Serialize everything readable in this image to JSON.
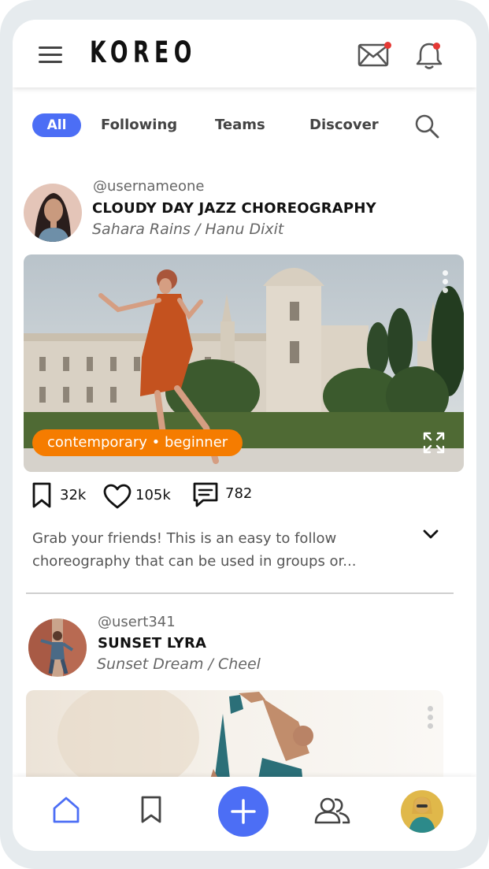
{
  "app": {
    "logo": "KOREO"
  },
  "tabs": [
    {
      "label": "All",
      "active": true
    },
    {
      "label": "Following",
      "active": false
    },
    {
      "label": "Teams",
      "active": false
    },
    {
      "label": "Discover",
      "active": false
    }
  ],
  "posts": [
    {
      "username": "@usernameone",
      "title": "CLOUDY DAY JAZZ CHOREOGRAPHY",
      "artist": "Sahara Rains / Hanu Dixit",
      "tag": "contemporary • beginner",
      "saves": "32k",
      "likes": "105k",
      "comments": "782",
      "description": "Grab your friends! This is an easy to follow choreography that can be used in groups or..."
    },
    {
      "username": "@usert341",
      "title": "SUNSET LYRA",
      "artist": "Sunset Dream / Cheel"
    }
  ],
  "colors": {
    "accent": "#4c6ef5",
    "tag": "#f57c00",
    "notification": "#e53935"
  },
  "icons": {
    "menu": "hamburger-menu-icon",
    "mail": "envelope-icon",
    "bell": "bell-icon",
    "search": "search-icon",
    "save": "bookmark-icon",
    "like": "heart-icon",
    "comment": "comment-icon",
    "expand": "expand-icon",
    "home": "home-icon",
    "add": "plus-icon",
    "friends": "users-icon"
  }
}
